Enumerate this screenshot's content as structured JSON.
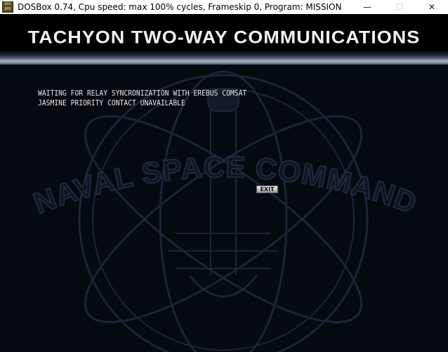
{
  "window": {
    "title": "DOSBox 0.74, Cpu speed: max 100% cycles, Frameskip  0, Program:  MISSION",
    "icon_text": "DOS BOX",
    "minimize_symbol": "—",
    "maximize_symbol": "☐",
    "close_symbol": "✕"
  },
  "screen": {
    "header_title": "TACHYON TWO-WAY COMMUNICATIONS",
    "emblem_text": "NAVAL SPACE COMMAND",
    "messages": [
      "WAITING FOR RELAY SYNCRONIZATION WITH EREBUS COMSAT",
      "JASMINE PRIORITY CONTACT UNAVAILABLE"
    ],
    "exit_label": "EXIT"
  },
  "colors": {
    "background": "#050a10",
    "emblem": "#1a2535",
    "text": "#e8e8e8"
  }
}
